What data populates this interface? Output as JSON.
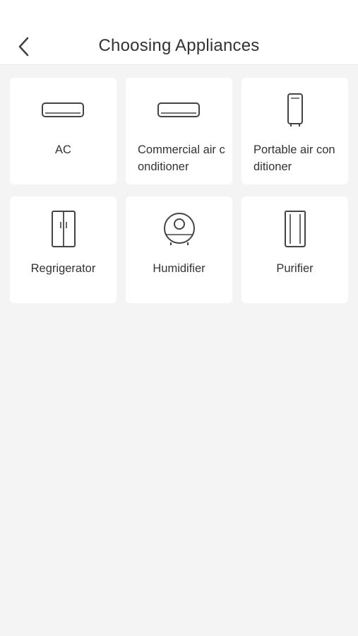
{
  "header": {
    "back_icon": "chevron-left-icon",
    "title": "Choosing Appliances"
  },
  "appliances": [
    {
      "label": "AC",
      "icon": "wall-ac-icon"
    },
    {
      "label": "Commercial air conditioner",
      "icon": "wall-ac-icon"
    },
    {
      "label": "Portable air conditioner",
      "icon": "portable-ac-icon"
    },
    {
      "label": "Regrigerator",
      "icon": "refrigerator-icon"
    },
    {
      "label": "Humidifier",
      "icon": "humidifier-icon"
    },
    {
      "label": "Purifier",
      "icon": "purifier-icon"
    }
  ],
  "colors": {
    "background": "#f4f4f4",
    "card": "#ffffff",
    "text": "#333333",
    "icon_stroke": "#444444"
  }
}
